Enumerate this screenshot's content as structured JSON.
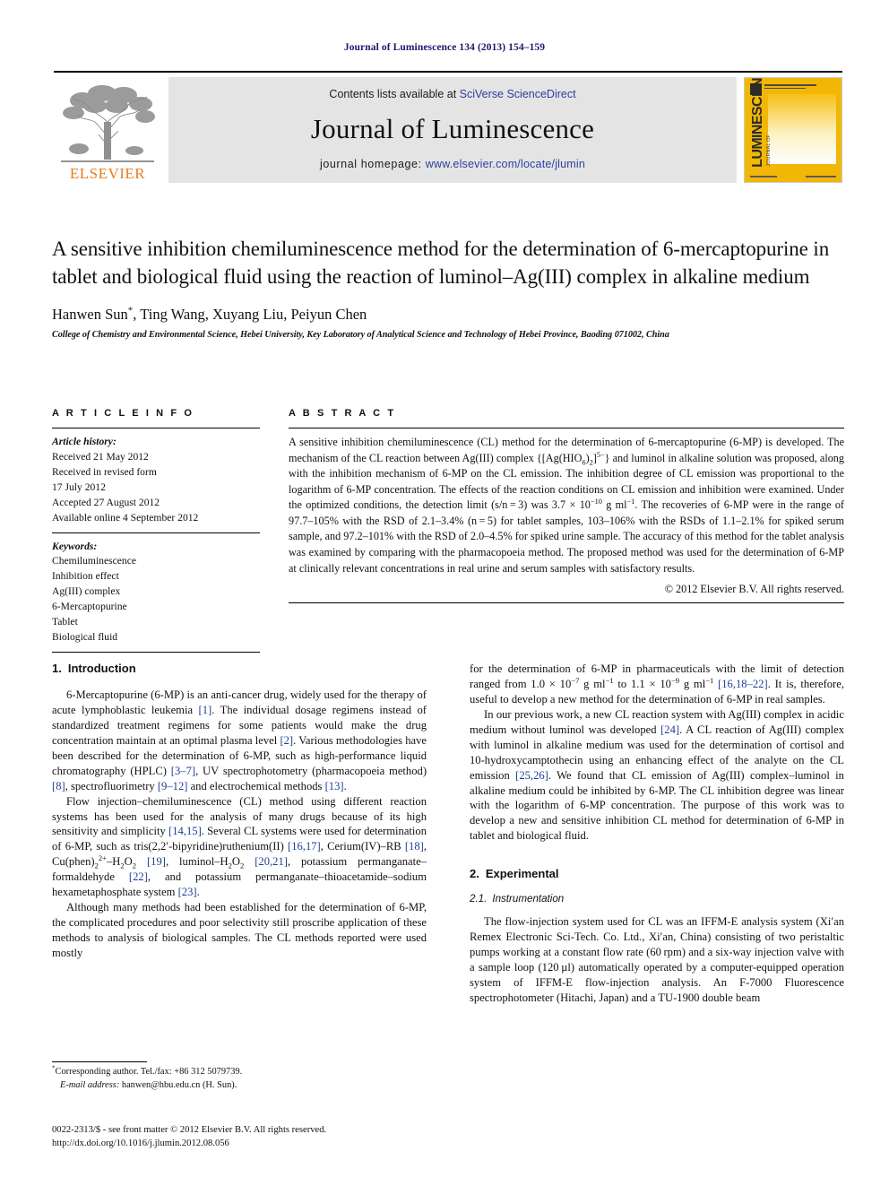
{
  "running_head": "Journal of Luminescence 134 (2013) 154–159",
  "masthead": {
    "contents_prefix": "Contents lists available at ",
    "sciencedirect_link": "SciVerse ScienceDirect",
    "journal_title": "Journal of Luminescence",
    "homepage_prefix": "journal homepage: ",
    "homepage_url": "www.elsevier.com/locate/jlumin",
    "publisher_wordmark": "ELSEVIER",
    "cover_title": "LUMINESCENCE",
    "cover_subtitle": "JOURNAL OF",
    "colors": {
      "band_background": "#e4e4e4",
      "link_blue": "#2b3f9e",
      "elsevier_orange": "#e87d1e",
      "cover_yellow": "#f2b705",
      "running_head_blue": "#1a1a6e"
    }
  },
  "article": {
    "title": "A sensitive inhibition chemiluminescence method for the determination of 6-mercaptopurine in tablet and biological fluid using the reaction of luminol–Ag(III) complex in alkaline medium",
    "authors": "Hanwen Sun",
    "authors_rest": ", Ting Wang, Xuyang Liu, Peiyun Chen",
    "corresponding_marker": "*",
    "affiliation": "College of Chemistry and Environmental Science, Hebei University, Key Laboratory of Analytical Science and Technology of Hebei Province, Baoding 071002, China"
  },
  "article_info": {
    "heading": "A R T I C L E   I N F O",
    "history_label": "Article history:",
    "history_lines": [
      "Received 21 May 2012",
      "Received in revised form",
      "17 July 2012",
      "Accepted 27 August 2012",
      "Available online 4 September 2012"
    ],
    "keywords_label": "Keywords:",
    "keywords": [
      "Chemiluminescence",
      "Inhibition effect",
      "Ag(III) complex",
      "6-Mercaptopurine",
      "Tablet",
      "Biological fluid"
    ]
  },
  "abstract": {
    "heading": "A B S T R A C T",
    "part1": "A sensitive inhibition chemiluminescence (CL) method for the determination of 6-mercaptopurine (6-MP) is developed. The mechanism of the CL reaction between Ag(III) complex {[Ag(HIO",
    "formula_sub1": "6",
    "formula_mid": ")",
    "formula_sub2": "2",
    "formula_bracket": "]",
    "formula_sup": "5−",
    "part2": "} and luminol in alkaline solution was proposed, along with the inhibition mechanism of 6-MP on the CL emission. The inhibition degree of CL emission was proportional to the logarithm of 6-MP concentration. The effects of the reaction conditions on CL emission and inhibition were examined. Under the optimized conditions, the detection limit (s/n = 3) was 3.7 × 10",
    "det_limit_exp": "−10",
    "part3": " g ml",
    "unit_exp": "−1",
    "part4": ". The recoveries of 6-MP were in the range of 97.7–105% with the RSD of 2.1–3.4% (n = 5) for tablet samples, 103–106% with the RSDs of 1.1–2.1% for spiked serum sample, and 97.2–101% with the RSD of 2.0–4.5% for spiked urine sample. The accuracy of this method for the tablet analysis was examined by comparing with the pharmacopoeia method. The proposed method was used for the determination of 6-MP at clinically relevant concentrations in real urine and serum samples with satisfactory results.",
    "copyright": "© 2012 Elsevier B.V. All rights reserved."
  },
  "sections": {
    "intro_number": "1.",
    "intro_title": "Introduction",
    "experimental_number": "2.",
    "experimental_title": "Experimental",
    "instrumentation_number": "2.1.",
    "instrumentation_title": "Instrumentation"
  },
  "left_column": {
    "p1_a": "6-Mercaptopurine (6-MP) is an anti-cancer drug, widely used for the therapy of acute lymphoblastic leukemia ",
    "p1_r1": "[1]",
    "p1_b": ". The individual dosage regimens instead of standardized treatment regimens for some patients would make the drug concentration maintain at an optimal plasma level ",
    "p1_r2": "[2]",
    "p1_c": ". Various methodologies have been described for the determination of 6-MP, such as high-performance liquid chromatography (HPLC) ",
    "p1_r3": "[3–7]",
    "p1_d": ", UV spectrophotometry (pharmacopoeia method) ",
    "p1_r4": "[8]",
    "p1_e": ", spectrofluorimetry ",
    "p1_r5": "[9–12]",
    "p1_f": " and electrochemical methods ",
    "p1_r6": "[13]",
    "p1_g": ".",
    "p2_a": "Flow injection–chemiluminescence (CL) method using different reaction systems has been used for the analysis of many drugs because of its high sensitivity and simplicity ",
    "p2_r1": "[14,15]",
    "p2_b": ". Several CL systems were used for determination of 6-MP, such as tris(2,2′-bipyridine)ruthenium(II) ",
    "p2_r2": "[16,17]",
    "p2_c": ", Cerium(IV)–RB ",
    "p2_r3": "[18]",
    "p2_d": ", Cu(phen)",
    "p2_cu_sub": "2",
    "p2_cu_sup": "2+",
    "p2_e": "–H",
    "p2_h2o2_sub1": "2",
    "p2_f": "O",
    "p2_h2o2_sub2": "2",
    "p2_g": " ",
    "p2_r4": "[19]",
    "p2_h": ", luminol–H",
    "p2_i": "O",
    "p2_j": " ",
    "p2_r5": "[20,21]",
    "p2_k": ", potassium permanganate–formaldehyde ",
    "p2_r6": "[22]",
    "p2_l": ", and potassium permanganate–thioacetamide–sodium hexametaphosphate system ",
    "p2_r7": "[23]",
    "p2_m": ".",
    "p3": "Although many methods had been established for the determination of 6-MP, the complicated procedures and poor selectivity still proscribe application of these methods to analysis of biological samples. The CL methods reported were used mostly"
  },
  "right_column": {
    "p1_a": "for the determination of 6-MP in pharmaceuticals with the limit of detection ranged from 1.0 × 10",
    "p1_exp1": "−7",
    "p1_b": " g ml",
    "p1_exp2": "−1",
    "p1_c": " to 1.1 × 10",
    "p1_exp3": "−9",
    "p1_d": " g ml",
    "p1_exp4": "−1",
    "p1_e": " ",
    "p1_r1": "[16,18–22]",
    "p1_f": ". It is, therefore, useful to develop a new method for the determination of 6-MP in real samples.",
    "p2_a": "In our previous work, a new CL reaction system with Ag(III) complex in acidic medium without luminol was developed ",
    "p2_r1": "[24]",
    "p2_b": ". A CL reaction of Ag(III) complex with luminol in alkaline medium was used for the determination of cortisol and 10-hydroxycamptothecin using an enhancing effect of the analyte on the CL emission ",
    "p2_r2": "[25,26]",
    "p2_c": ". We found that CL emission of Ag(III) complex–luminol in alkaline medium could be inhibited by 6-MP. The CL inhibition degree was linear with the logarithm of 6-MP concentration. The purpose of this work was to develop a new and sensitive inhibition CL method for determination of 6-MP in tablet and biological fluid.",
    "p3": "The flow-injection system used for CL was an IFFM-E analysis system (Xi′an Remex Electronic Sci-Tech. Co. Ltd., Xi′an, China) consisting of two peristaltic pumps working at a constant flow rate (60 rpm) and a six-way injection valve with a sample loop (120 µl) automatically operated by a computer-equipped operation system of IFFM-E flow-injection analysis. An F-7000 Fluorescence spectrophotometer (Hitachi, Japan) and a TU-1900 double beam"
  },
  "footnote": {
    "marker": "*",
    "corresponding": "Corresponding author. Tel./fax: +86 312 5079739.",
    "email_label": "E-mail address:",
    "email": " hanwen@hbu.edu.cn (H. Sun)."
  },
  "bottom_meta": {
    "issn_line": "0022-2313/$ - see front matter © 2012 Elsevier B.V. All rights reserved.",
    "doi_line": "http://dx.doi.org/10.1016/j.jlumin.2012.08.056"
  }
}
